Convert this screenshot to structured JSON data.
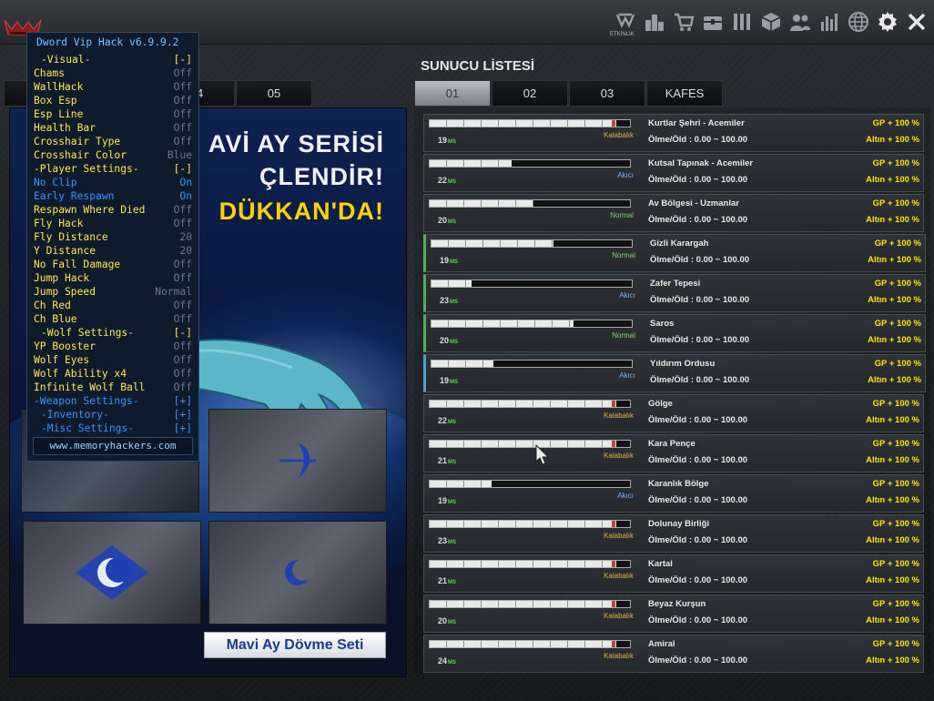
{
  "topbar": {
    "icons": [
      "wolf-logo-icon",
      "etkinlik-icon",
      "city-icon",
      "cart-icon",
      "chest-icon",
      "armory-icon",
      "box-icon",
      "friends-icon",
      "stats-icon",
      "globe-icon",
      "gear-icon",
      "close-icon"
    ],
    "etkinlik_label": "ETKİNLİK"
  },
  "left": {
    "title": "",
    "tabs": [
      "",
      "",
      "04",
      "05"
    ],
    "active_tab": 1
  },
  "promo": {
    "line1": "AVİ AY SERİSİ",
    "line2": "ÇLENDİR!",
    "line3": "DÜKKAN'DA!",
    "button": "Mavi Ay Dövme Seti"
  },
  "hack": {
    "title": "Dword Vip Hack v6.9.9.2",
    "rows": [
      {
        "label": "-Visual-",
        "value": "[-]",
        "color": "yellow",
        "indent": true
      },
      {
        "label": "Chams",
        "value": "Off",
        "color": "yellow"
      },
      {
        "label": "WallHack",
        "value": "Off",
        "color": "yellow"
      },
      {
        "label": "Box Esp",
        "value": "Off",
        "color": "yellow"
      },
      {
        "label": "Esp Line",
        "value": "Off",
        "color": "yellow"
      },
      {
        "label": "Health Bar",
        "value": "Off",
        "color": "yellow"
      },
      {
        "label": "Crosshair Type",
        "value": "Off",
        "color": "yellow"
      },
      {
        "label": "Crosshair Color",
        "value": "Blue",
        "color": "yellow"
      },
      {
        "label": "-Player Settings-",
        "value": "[-]",
        "color": "yellow"
      },
      {
        "label": "No Clip",
        "value": "On",
        "color": "blue"
      },
      {
        "label": "Early Respawn",
        "value": "On",
        "color": "blue"
      },
      {
        "label": "Respawn Where Died",
        "value": "Off",
        "color": "yellow"
      },
      {
        "label": "Fly Hack",
        "value": "Off",
        "color": "yellow"
      },
      {
        "label": "Fly Distance",
        "value": "20",
        "color": "yellow"
      },
      {
        "label": "Y Distance",
        "value": "20",
        "color": "yellow"
      },
      {
        "label": "No Fall Damage",
        "value": "Off",
        "color": "yellow"
      },
      {
        "label": "Jump Hack",
        "value": "Off",
        "color": "yellow"
      },
      {
        "label": "Jump Speed",
        "value": "Normal",
        "color": "yellow"
      },
      {
        "label": "Ch Red",
        "value": "Off",
        "color": "yellow"
      },
      {
        "label": "Ch Blue",
        "value": "Off",
        "color": "yellow"
      },
      {
        "label": "-Wolf Settings-",
        "value": "[-]",
        "color": "yellow",
        "indent": true
      },
      {
        "label": "YP Booster",
        "value": "Off",
        "color": "yellow"
      },
      {
        "label": "Wolf Eyes",
        "value": "Off",
        "color": "yellow"
      },
      {
        "label": "Wolf Ability x4",
        "value": "Off",
        "color": "yellow"
      },
      {
        "label": "Infinite Wolf Ball",
        "value": "Off",
        "color": "yellow"
      },
      {
        "label": "-Weapon Settings-",
        "value": "[+]",
        "color": "blue"
      },
      {
        "label": "-Inventory-",
        "value": "[+]",
        "color": "blue",
        "indent": true
      },
      {
        "label": "-Misc Settings-",
        "value": "[+]",
        "color": "blue",
        "indent": true
      }
    ],
    "footer": "www.memoryhackers.com"
  },
  "servers": {
    "title": "SUNUCU LİSTESİ",
    "tabs": [
      "01",
      "02",
      "03",
      "KAFES"
    ],
    "active_tab": 0,
    "ms_unit": "MS",
    "rows": [
      {
        "ping": "19",
        "status": "Kalabalık",
        "status_type": "k",
        "load": 0.93,
        "red": true,
        "name": "Kurtlar Şehri - Acemiler",
        "kd": "Ölme/Öld : 0.00 ~ 100.00",
        "gp": "GP + 100 %",
        "altin": "Altın + 100 %",
        "sel": ""
      },
      {
        "ping": "22",
        "status": "Akıcı",
        "status_type": "a",
        "load": 0.41,
        "red": false,
        "name": "Kutsal Tapınak - Acemiler",
        "kd": "Ölme/Öld : 0.00 ~ 100.00",
        "gp": "GP + 100 %",
        "altin": "Altın + 100 %",
        "sel": ""
      },
      {
        "ping": "20",
        "status": "Normal",
        "status_type": "n",
        "load": 0.52,
        "red": false,
        "name": "Av Bölgesi - Uzmanlar",
        "kd": "Ölme/Öld : 0.00 ~ 100.00",
        "gp": "GP + 100 %",
        "altin": "Altın + 100 %",
        "sel": ""
      },
      {
        "ping": "19",
        "status": "Normal",
        "status_type": "n",
        "load": 0.61,
        "red": false,
        "name": "Gizli Karargah",
        "kd": "Ölme/Öld : 0.00 ~ 100.00",
        "gp": "GP + 100 %",
        "altin": "Altın + 100 %",
        "sel": "green"
      },
      {
        "ping": "23",
        "status": "Akıcı",
        "status_type": "a",
        "load": 0.2,
        "red": false,
        "name": "Zafer Tepesi",
        "kd": "Ölme/Öld : 0.00 ~ 100.00",
        "gp": "GP + 100 %",
        "altin": "Altın + 100 %",
        "sel": "green"
      },
      {
        "ping": "20",
        "status": "Normal",
        "status_type": "n",
        "load": 0.71,
        "red": false,
        "name": "Saros",
        "kd": "Ölme/Öld : 0.00 ~ 100.00",
        "gp": "GP + 100 %",
        "altin": "Altın + 100 %",
        "sel": "green"
      },
      {
        "ping": "19",
        "status": "Akıcı",
        "status_type": "a",
        "load": 0.31,
        "red": false,
        "name": "Yıldırım Ordusu",
        "kd": "Ölme/Öld : 0.00 ~ 100.00",
        "gp": "GP + 100 %",
        "altin": "Altın + 100 %",
        "sel": "blue"
      },
      {
        "ping": "22",
        "status": "Kalabalık",
        "status_type": "k",
        "load": 0.93,
        "red": true,
        "name": "Gölge",
        "kd": "Ölme/Öld : 0.00 ~ 100.00",
        "gp": "GP + 100 %",
        "altin": "Altın + 100 %",
        "sel": ""
      },
      {
        "ping": "21",
        "status": "Kalabalık",
        "status_type": "k",
        "load": 0.93,
        "red": true,
        "name": "Kara Pençe",
        "kd": "Ölme/Öld : 0.00 ~ 100.00",
        "gp": "GP + 100 %",
        "altin": "Altın + 100 %",
        "sel": ""
      },
      {
        "ping": "19",
        "status": "Akıcı",
        "status_type": "a",
        "load": 0.31,
        "red": false,
        "name": "Karanlık Bölge",
        "kd": "Ölme/Öld : 0.00 ~ 100.00",
        "gp": "GP + 100 %",
        "altin": "Altın + 100 %",
        "sel": ""
      },
      {
        "ping": "23",
        "status": "Kalabalık",
        "status_type": "k",
        "load": 0.93,
        "red": true,
        "name": "Dolunay Birliği",
        "kd": "Ölme/Öld : 0.00 ~ 100.00",
        "gp": "GP + 100 %",
        "altin": "Altın + 100 %",
        "sel": ""
      },
      {
        "ping": "21",
        "status": "Kalabalık",
        "status_type": "k",
        "load": 0.93,
        "red": true,
        "name": "Kartal",
        "kd": "Ölme/Öld : 0.00 ~ 100.00",
        "gp": "GP + 100 %",
        "altin": "Altın + 100 %",
        "sel": ""
      },
      {
        "ping": "20",
        "status": "Kalabalık",
        "status_type": "k",
        "load": 0.93,
        "red": true,
        "name": "Beyaz Kurşun",
        "kd": "Ölme/Öld : 0.00 ~ 100.00",
        "gp": "GP + 100 %",
        "altin": "Altın + 100 %",
        "sel": ""
      },
      {
        "ping": "24",
        "status": "Kalabalık",
        "status_type": "k",
        "load": 0.93,
        "red": true,
        "name": "Amiral",
        "kd": "Ölme/Öld : 0.00 ~ 100.00",
        "gp": "GP + 100 %",
        "altin": "Altın + 100 %",
        "sel": ""
      }
    ]
  },
  "colors": {
    "accent_yellow": "#ffe600",
    "hack_yellow": "#ffe94a",
    "hack_blue": "#3a93ff",
    "status_crowded": "#e0b24a",
    "status_smooth": "#7cb3ff",
    "status_normal": "#7ed36a"
  }
}
